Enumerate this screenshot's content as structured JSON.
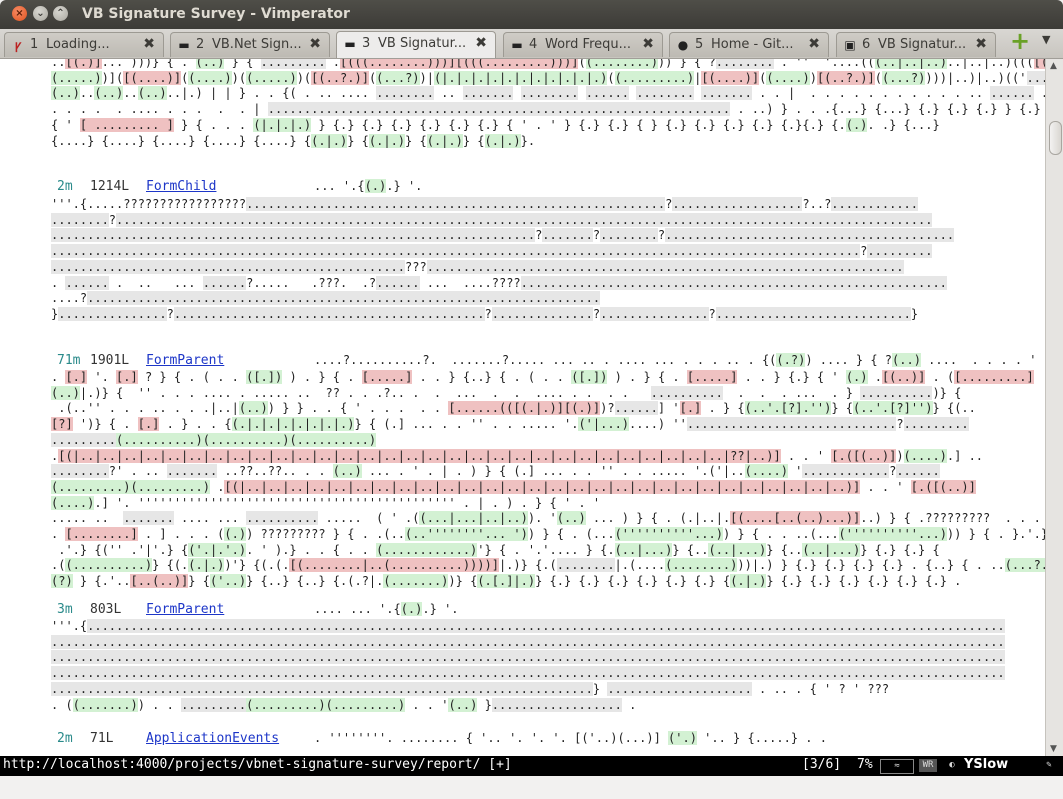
{
  "window": {
    "title": "VB Signature Survey - Vimperator",
    "buttons": {
      "close": "×",
      "minimize": "⌄",
      "maximize": "⌃"
    }
  },
  "tabs": [
    {
      "num": "1",
      "label": "Loading...",
      "icon": "vimperator-icon",
      "active": false
    },
    {
      "num": "2",
      "label": "VB.Net Sign...",
      "icon": "page-icon",
      "active": false
    },
    {
      "num": "3",
      "label": "VB Signatur...",
      "icon": "page-icon",
      "active": true
    },
    {
      "num": "4",
      "label": "Word Frequ...",
      "icon": "page-icon",
      "active": false
    },
    {
      "num": "5",
      "label": "Home - Git...",
      "icon": "github-icon",
      "active": false
    },
    {
      "num": "6",
      "label": "VB Signatur...",
      "icon": "page-icon",
      "active": false
    }
  ],
  "tabbar": {
    "add": "+",
    "menu": "▼"
  },
  "content": {
    "top_lines": [
      "..[(.)]... )))} { . (..) } { ......... .[(((........)))][(((.........)))]((........))) } { ?........ . ''  '....(((..|..|..)..|..|..)((([(....)]..)",
      "(.....))]([(....)]((....))((.....))([(..?.)]((...?))|(|.|.|.|.|.|.|.|.|.|.|.)((.........)|[(....)]((....))[(..?.)]((...?))))|..)|..)(('.........",
      "(..)..(..)..(..)..|.) | | } . . {( . .. .... ........ .. ....... ........ ...... ........ ....... . . |  . . . . . . . . . . . .. ...... . .. ..",
      ". . . .  . .... . . .  .  . | ................................................................ . ..) } . . .{...} {...} {.} {.} {.} } {.} {.} .",
      "{ ' [ ......... ] } { . . . (|.|.|.) } {.} {.} {.} {.} {.} {.} { ' . ' } {.} {.} { } {.} {.} {.} {.} {.}{.} {.(.). .} {...}",
      "{....} {....} {....} {....} {....} {(.|.)} {(.|.)} {(.|.)} {(.|.)}."
    ],
    "entries": [
      {
        "time": "2m",
        "lines": "1214L",
        "name": "FormChild",
        "preview": "... '.{(.).} '.",
        "body": [
          "'''.{.....?????????????????..........................................................?..................?..?............",
          "........?.................................................................................................................",
          "...................................................................?.......?........?........................................",
          "................................................................................................................?.........",
          ".................................................???..................................................................",
          ". ...... .  ..   ... ......?.....   .???.  .?...... ...  ....????...........................................................",
          "....?.......................................................................",
          "}...............?...........................................?..............?...............?...........................}"
        ]
      },
      {
        "time": "71m",
        "lines": "1901L",
        "name": "FormParent",
        "preview": "....?..........?.  .......?..... ... .. . .... ... . . . .. . {((.?)) .... } { ?(..) ....  . . . . '",
        "body": [
          ". [.] '. [.] ? } { . ( . . ([.]) ) . } { . [.....] . . } {..} { . ( . . ([.]) ) . } { . [.....] . . } {.} { ' (.) .[(..)] . ([.........]",
          "(..)|.)} {  '' . . . .... . ..... ..  ?? . . .?.. .  .  ...  .  .  .... . .  . .   ..........  .  .  . ...  . } ..........)} {",
          " .(..'' . . . .. . . .|..|(..)) } } . . { ' . . .  . . [......(([(.|.)][(.)])?......] '[.] . } {(..'.[?].'')} {(..'.[?]'')} {(..",
          "[?] ')} { . [.] . } . . {(.|.|.|.|.|.|.|.)} { (.] ... . . '' . . ..... '.('|...)....) ''.............................?.........",
          ".........(..........)(..........)(..........)",
          ".[(|..|..|..|..|..|..|..|..|..|..|..|..|..|..|..|..|..|..|..|..|..|..|..|..|..|..|..|..|..|..|??|..)] . . ' [.([(..)])(....).] ..",
          "........?' . .. ....... ..??..??.. . . (..) ... . ' . | . ) } { (.] ... . . '' . . ..... '.('|..(....) '............?......",
          "(.........)(.........) .[(|..|..|..|..|..|..|..|..|..|..|..|..|..|..|..|..|..|..|..|..|..|..|..|..|..|..|..|..)] . . ' [.([(..)]",
          "(....).] '. '''''''''''''''''''''''''''''''''''''''''''' . | . ) . } { ' . '",
          "..... ..  ....... .... ... .......... .....  ( ' .((...|...|..|..)). '(..) ... ) } { . (.|..|.[(....[..(..)...)]..) } { .?????????  . . . . . .",
          ". [........] . ] . . . ((.)) ????????? } { . .(..(..''''''''... ')) } { . (...(''''''''''...)) } { . . ..(...(''''''''''...))) } { . }.'.}",
          " .'.} {('' .'|'.} {('.|.'.). ' ).} . . { . . (............)'} { . '.'.... } {.(..|...)} {..(..|...)} {..(..|...)} {.} {.} {",
          ".((..........)} {(.(.|.))'} {(.(.[(........|..(..........))))]|.)} {.(........|.(....(........)))|.) } {.} {.} {.} {.} . {..} { . ..(...?..)",
          "(?) } {.'..[..(..)]} {('..)} {..} {..} {.(.?|.(.......))} {(.[.]|.)} {.} {.} {.} {.} {.} {.} {(.|.)} {.} {.} {.} {.} {.} {.} ."
        ]
      },
      {
        "time": "3m",
        "lines": "803L",
        "name": "FormParent",
        "preview": ".... ... '.{(.).} '.",
        "body": [
          "'''.{...............................................................................................................................",
          "....................................................................................................................................",
          "....................................................................................................................................",
          "....................................................................................................................................",
          "...........................................................................} .................... . .. . { ' ? ' ???",
          ". ((.......)) . . .........(.........)(.........) . . '(..) }.................. ."
        ]
      },
      {
        "time": "2m",
        "lines": "71L",
        "name": "ApplicationEvents",
        "preview": ". ''''''''. ........ { '.. '. '. '. [('..)(...)] ('.) '.. } {.....} . .",
        "body": []
      }
    ]
  },
  "scrollbar": {
    "up": "▲",
    "down": "▼"
  },
  "statusbar": {
    "url": "http://localhost:4000/projects/vbnet-signature-survey/report/ [+]",
    "tab_position": "[3/6]",
    "scroll_percent": "7%",
    "icon1": "≈",
    "icon2": "WR",
    "yslow": "YSlow"
  }
}
